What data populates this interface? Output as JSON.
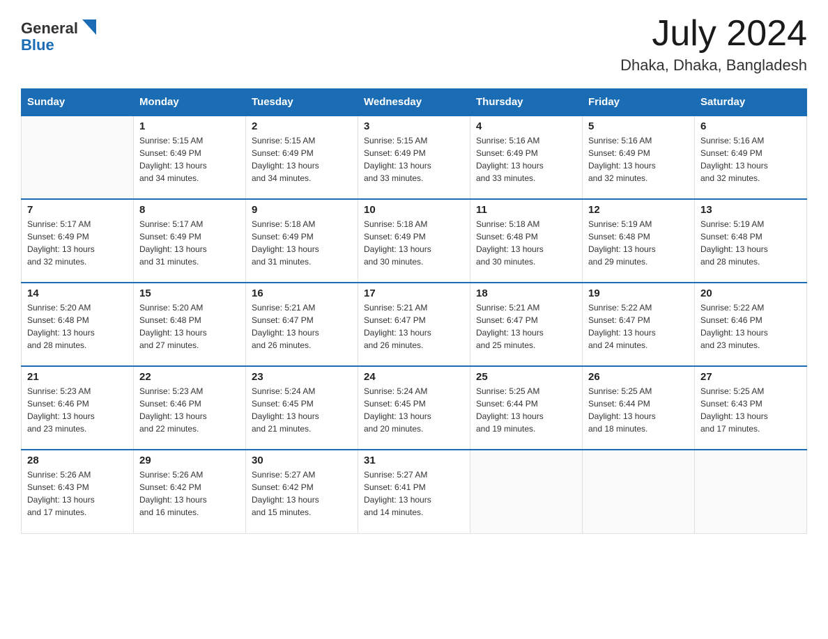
{
  "header": {
    "logo_text_black": "General",
    "logo_text_blue": "Blue",
    "month": "July 2024",
    "location": "Dhaka, Dhaka, Bangladesh"
  },
  "days_of_week": [
    "Sunday",
    "Monday",
    "Tuesday",
    "Wednesday",
    "Thursday",
    "Friday",
    "Saturday"
  ],
  "weeks": [
    [
      {
        "day": "",
        "info": ""
      },
      {
        "day": "1",
        "info": "Sunrise: 5:15 AM\nSunset: 6:49 PM\nDaylight: 13 hours\nand 34 minutes."
      },
      {
        "day": "2",
        "info": "Sunrise: 5:15 AM\nSunset: 6:49 PM\nDaylight: 13 hours\nand 34 minutes."
      },
      {
        "day": "3",
        "info": "Sunrise: 5:15 AM\nSunset: 6:49 PM\nDaylight: 13 hours\nand 33 minutes."
      },
      {
        "day": "4",
        "info": "Sunrise: 5:16 AM\nSunset: 6:49 PM\nDaylight: 13 hours\nand 33 minutes."
      },
      {
        "day": "5",
        "info": "Sunrise: 5:16 AM\nSunset: 6:49 PM\nDaylight: 13 hours\nand 32 minutes."
      },
      {
        "day": "6",
        "info": "Sunrise: 5:16 AM\nSunset: 6:49 PM\nDaylight: 13 hours\nand 32 minutes."
      }
    ],
    [
      {
        "day": "7",
        "info": "Sunrise: 5:17 AM\nSunset: 6:49 PM\nDaylight: 13 hours\nand 32 minutes."
      },
      {
        "day": "8",
        "info": "Sunrise: 5:17 AM\nSunset: 6:49 PM\nDaylight: 13 hours\nand 31 minutes."
      },
      {
        "day": "9",
        "info": "Sunrise: 5:18 AM\nSunset: 6:49 PM\nDaylight: 13 hours\nand 31 minutes."
      },
      {
        "day": "10",
        "info": "Sunrise: 5:18 AM\nSunset: 6:49 PM\nDaylight: 13 hours\nand 30 minutes."
      },
      {
        "day": "11",
        "info": "Sunrise: 5:18 AM\nSunset: 6:48 PM\nDaylight: 13 hours\nand 30 minutes."
      },
      {
        "day": "12",
        "info": "Sunrise: 5:19 AM\nSunset: 6:48 PM\nDaylight: 13 hours\nand 29 minutes."
      },
      {
        "day": "13",
        "info": "Sunrise: 5:19 AM\nSunset: 6:48 PM\nDaylight: 13 hours\nand 28 minutes."
      }
    ],
    [
      {
        "day": "14",
        "info": "Sunrise: 5:20 AM\nSunset: 6:48 PM\nDaylight: 13 hours\nand 28 minutes."
      },
      {
        "day": "15",
        "info": "Sunrise: 5:20 AM\nSunset: 6:48 PM\nDaylight: 13 hours\nand 27 minutes."
      },
      {
        "day": "16",
        "info": "Sunrise: 5:21 AM\nSunset: 6:47 PM\nDaylight: 13 hours\nand 26 minutes."
      },
      {
        "day": "17",
        "info": "Sunrise: 5:21 AM\nSunset: 6:47 PM\nDaylight: 13 hours\nand 26 minutes."
      },
      {
        "day": "18",
        "info": "Sunrise: 5:21 AM\nSunset: 6:47 PM\nDaylight: 13 hours\nand 25 minutes."
      },
      {
        "day": "19",
        "info": "Sunrise: 5:22 AM\nSunset: 6:47 PM\nDaylight: 13 hours\nand 24 minutes."
      },
      {
        "day": "20",
        "info": "Sunrise: 5:22 AM\nSunset: 6:46 PM\nDaylight: 13 hours\nand 23 minutes."
      }
    ],
    [
      {
        "day": "21",
        "info": "Sunrise: 5:23 AM\nSunset: 6:46 PM\nDaylight: 13 hours\nand 23 minutes."
      },
      {
        "day": "22",
        "info": "Sunrise: 5:23 AM\nSunset: 6:46 PM\nDaylight: 13 hours\nand 22 minutes."
      },
      {
        "day": "23",
        "info": "Sunrise: 5:24 AM\nSunset: 6:45 PM\nDaylight: 13 hours\nand 21 minutes."
      },
      {
        "day": "24",
        "info": "Sunrise: 5:24 AM\nSunset: 6:45 PM\nDaylight: 13 hours\nand 20 minutes."
      },
      {
        "day": "25",
        "info": "Sunrise: 5:25 AM\nSunset: 6:44 PM\nDaylight: 13 hours\nand 19 minutes."
      },
      {
        "day": "26",
        "info": "Sunrise: 5:25 AM\nSunset: 6:44 PM\nDaylight: 13 hours\nand 18 minutes."
      },
      {
        "day": "27",
        "info": "Sunrise: 5:25 AM\nSunset: 6:43 PM\nDaylight: 13 hours\nand 17 minutes."
      }
    ],
    [
      {
        "day": "28",
        "info": "Sunrise: 5:26 AM\nSunset: 6:43 PM\nDaylight: 13 hours\nand 17 minutes."
      },
      {
        "day": "29",
        "info": "Sunrise: 5:26 AM\nSunset: 6:42 PM\nDaylight: 13 hours\nand 16 minutes."
      },
      {
        "day": "30",
        "info": "Sunrise: 5:27 AM\nSunset: 6:42 PM\nDaylight: 13 hours\nand 15 minutes."
      },
      {
        "day": "31",
        "info": "Sunrise: 5:27 AM\nSunset: 6:41 PM\nDaylight: 13 hours\nand 14 minutes."
      },
      {
        "day": "",
        "info": ""
      },
      {
        "day": "",
        "info": ""
      },
      {
        "day": "",
        "info": ""
      }
    ]
  ]
}
